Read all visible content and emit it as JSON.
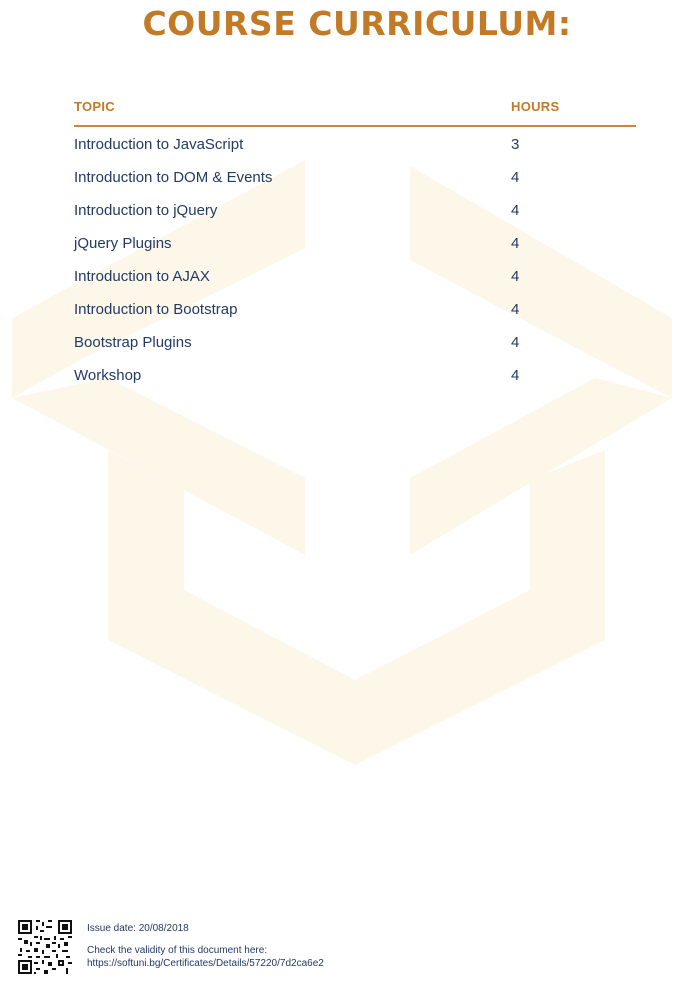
{
  "page_title": "COURSE CURRICULUM:",
  "table": {
    "headers": {
      "topic": "TOPIC",
      "hours": "HOURS"
    },
    "rows": [
      {
        "topic": "Introduction to JavaScript",
        "hours": "3"
      },
      {
        "topic": "Introduction to DOM & Events",
        "hours": "4"
      },
      {
        "topic": "Introduction to jQuery",
        "hours": "4"
      },
      {
        "topic": "jQuery Plugins",
        "hours": "4"
      },
      {
        "topic": "Introduction to AJAX",
        "hours": "4"
      },
      {
        "topic": "Introduction to Bootstrap",
        "hours": "4"
      },
      {
        "topic": "Bootstrap Plugins",
        "hours": "4"
      },
      {
        "topic": "Workshop",
        "hours": "4"
      }
    ]
  },
  "footer": {
    "issue_date": "Issue date: 20/08/2018",
    "validity_text": "Check the validity of this document here:",
    "validity_url": "https://softuni.bg/Certificates/Details/57220/7d2ca6e2"
  },
  "icons": {
    "watermark": "softuni-logo-watermark",
    "qr": "qr-code-icon"
  },
  "colors": {
    "accent": "#c27a26",
    "text": "#233a63",
    "watermark": "#fdf7ea"
  }
}
